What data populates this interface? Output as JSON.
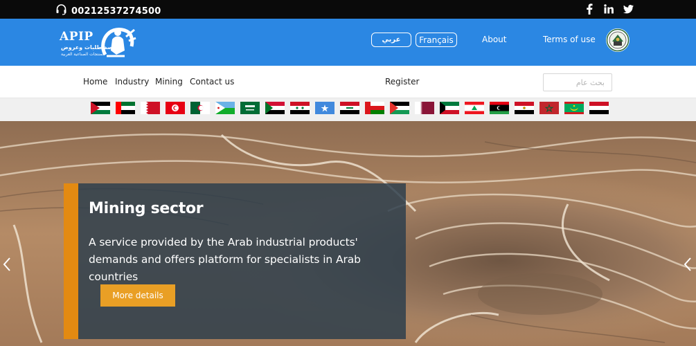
{
  "topbar": {
    "phone": "00212537274500",
    "social": [
      "facebook-icon",
      "linkedin-icon",
      "twitter-icon"
    ]
  },
  "header": {
    "logo_text": "APIP",
    "logo_arabic_line1": "منصة طلبات وعروض",
    "logo_arabic_line2": "المنتجات الصناعية العربية",
    "lang_arabic": "عربي",
    "lang_french": "Français",
    "about": "About",
    "terms": "Terms of use"
  },
  "nav": {
    "home": "Home",
    "industry": "Industry",
    "mining": "Mining",
    "contact": "Contact us",
    "register": "Register",
    "search_placeholder": "بحث عام"
  },
  "flags": [
    "Jordan",
    "UAE",
    "Bahrain",
    "Tunisia",
    "Algeria",
    "Djibouti",
    "Saudi Arabia",
    "Sudan",
    "Syria",
    "Somalia",
    "Iraq",
    "Oman",
    "Palestine",
    "Qatar",
    "Kuwait",
    "Lebanon",
    "Libya",
    "Egypt",
    "Morocco",
    "Mauritania",
    "Yemen"
  ],
  "hero": {
    "title": "Mining sector",
    "description": "A service provided by the Arab industrial products' demands and offers platform for specialists in Arab countries",
    "button": "More details"
  },
  "colors": {
    "header_blue": "#2b87e3",
    "accent_orange": "#e38a12",
    "button_orange": "#e99f25",
    "topbar": "#0a0a0a"
  }
}
